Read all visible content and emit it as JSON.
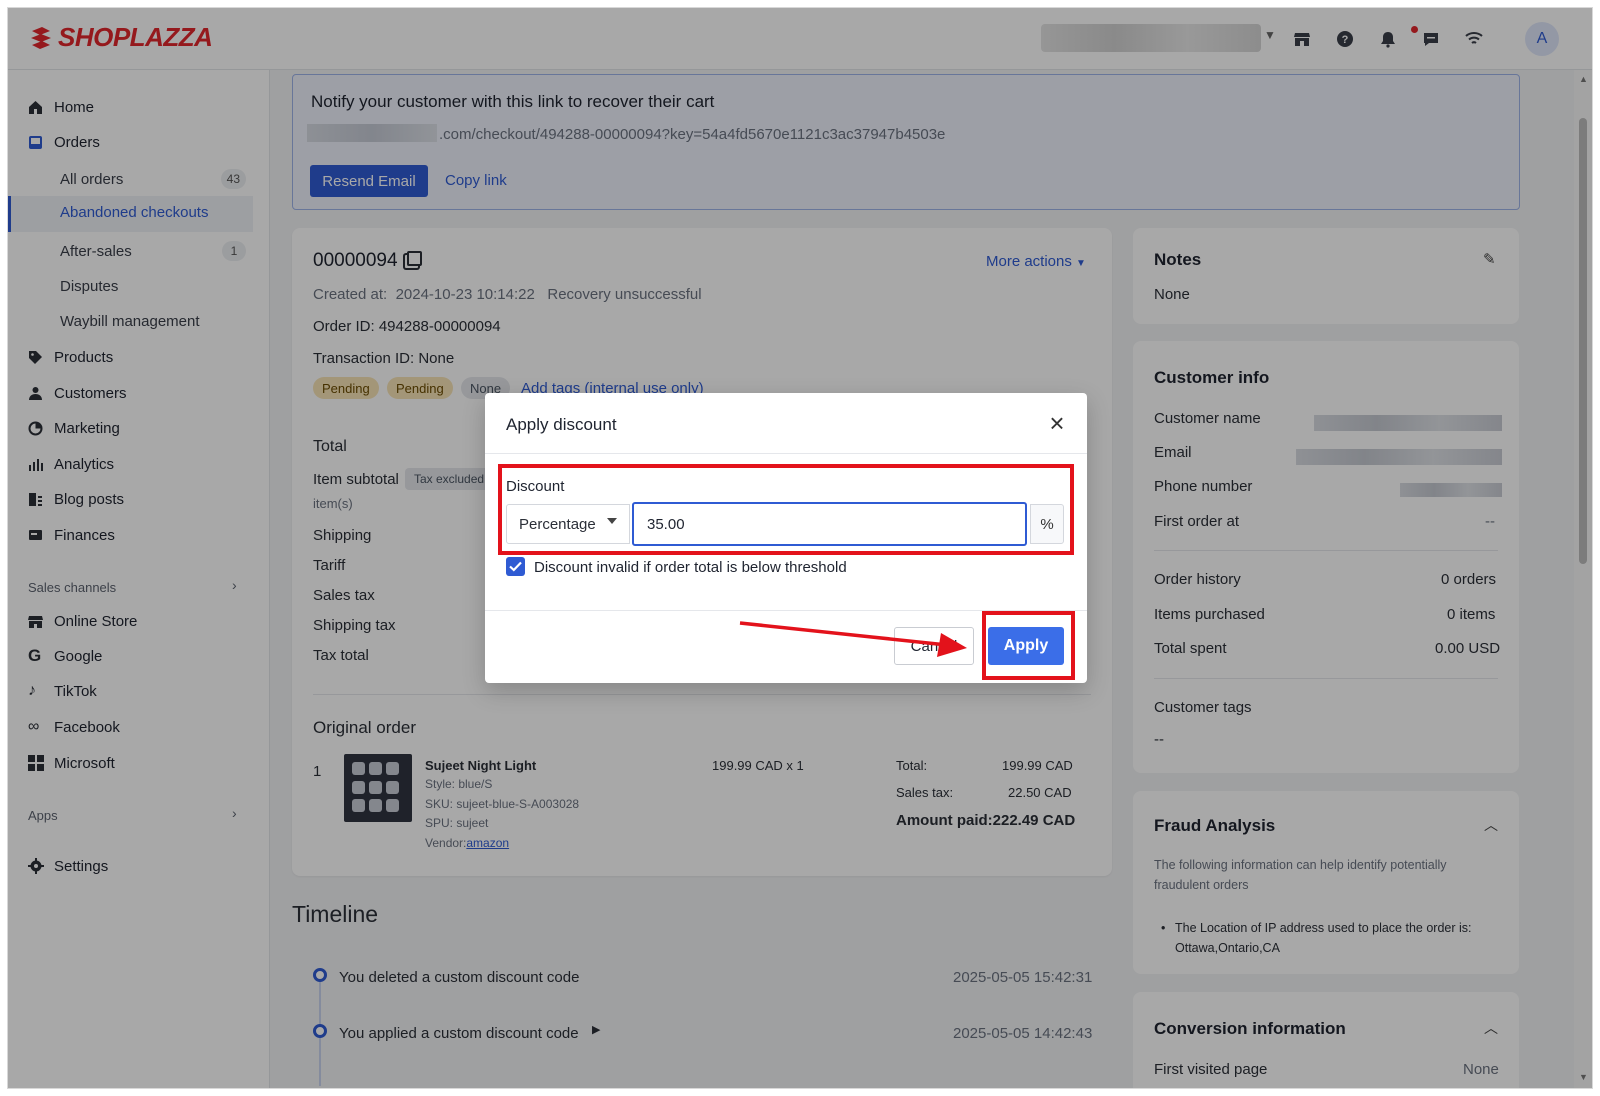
{
  "brand": {
    "name": "SHOPLAZZA",
    "color": "#e2262d"
  },
  "topbar": {
    "icons": [
      "store-icon",
      "help-icon",
      "bell-icon",
      "chat-icon",
      "wifi-icon"
    ],
    "avatar": "A"
  },
  "sidebar": {
    "items": [
      {
        "label": "Home",
        "icon": "home-icon"
      },
      {
        "label": "Orders",
        "icon": "orders-icon"
      },
      {
        "label": "Products",
        "icon": "tag-icon"
      },
      {
        "label": "Customers",
        "icon": "user-icon"
      },
      {
        "label": "Marketing",
        "icon": "marketing-icon"
      },
      {
        "label": "Analytics",
        "icon": "bar-chart-icon"
      },
      {
        "label": "Blog posts",
        "icon": "blog-icon"
      },
      {
        "label": "Finances",
        "icon": "finance-icon"
      }
    ],
    "orders_sub": [
      {
        "label": "All orders",
        "count": "43"
      },
      {
        "label": "Abandoned checkouts",
        "count": ""
      },
      {
        "label": "After-sales",
        "count": "1"
      },
      {
        "label": "Disputes",
        "count": ""
      },
      {
        "label": "Waybill management",
        "count": ""
      }
    ],
    "sales_channels_label": "Sales channels",
    "channels": [
      {
        "label": "Online Store",
        "icon": "store-icon"
      },
      {
        "label": "Google",
        "icon": "google-icon"
      },
      {
        "label": "TikTok",
        "icon": "tiktok-icon"
      },
      {
        "label": "Facebook",
        "icon": "meta-icon"
      },
      {
        "label": "Microsoft",
        "icon": "microsoft-icon"
      }
    ],
    "apps_label": "Apps",
    "settings_label": "Settings"
  },
  "banner": {
    "title": "Notify your customer with this link to recover their cart",
    "url": ".com/checkout/494288-00000094?key=54a4fd5670e1121c3ac37947b4503e",
    "resend_label": "Resend Email",
    "copy_label": "Copy link"
  },
  "order": {
    "number": "00000094",
    "more_actions": "More actions",
    "created_label": "Created at:",
    "created_value": "2024-10-23 10:14:22",
    "recovery_status": "Recovery unsuccessful",
    "order_id": "Order ID: 494288-00000094",
    "transaction_id": "Transaction ID: None",
    "tags": [
      "Pending",
      "Pending",
      "None"
    ],
    "add_tags": "Add tags (internal use only)",
    "total_heading": "Total",
    "item_subtotal": "Item subtotal",
    "tax_excluded": "Tax excluded",
    "items_label": "item(s)",
    "rows": [
      "Shipping",
      "Tariff",
      "Sales tax",
      "Shipping tax",
      "Tax total"
    ],
    "original_order_heading": "Original order",
    "line": {
      "index": "1",
      "name": "Sujeet Night Light",
      "style": "Style: blue/S",
      "sku": "SKU: sujeet-blue-S-A003028",
      "spu": "SPU: sujeet",
      "vendor_label": "Vendor:",
      "vendor": "amazon",
      "price_qty": "199.99 CAD x 1",
      "total_label": "Total:",
      "total_value": "199.99 CAD",
      "sales_tax_label": "Sales tax:",
      "sales_tax_value": "22.50 CAD",
      "amount_paid": "Amount paid:222.49 CAD"
    }
  },
  "timeline": {
    "heading": "Timeline",
    "events": [
      {
        "text": "You deleted a custom discount code",
        "time": "2025-05-05 15:42:31"
      },
      {
        "text": "You applied a custom discount code",
        "time": "2025-05-05 14:42:43"
      }
    ]
  },
  "notes": {
    "title": "Notes",
    "value": "None"
  },
  "customer": {
    "title": "Customer info",
    "name_label": "Customer name",
    "email_label": "Email",
    "phone_label": "Phone number",
    "first_order_label": "First order at",
    "first_order_value": "--",
    "order_history_label": "Order history",
    "order_history_value": "0 orders",
    "items_purchased_label": "Items purchased",
    "items_purchased_value": "0 items",
    "total_spent_label": "Total spent",
    "total_spent_value": "0.00 USD",
    "tags_label": "Customer tags",
    "tags_value": "--"
  },
  "fraud": {
    "title": "Fraud Analysis",
    "desc": "The following information can help identify potentially fraudulent orders",
    "bullet": "The Location of IP address used to place the order is: Ottawa,Ontario,CA"
  },
  "conversion": {
    "title": "Conversion information",
    "first_page_label": "First visited page",
    "first_page_value": "None"
  },
  "modal": {
    "title": "Apply discount",
    "discount_label": "Discount",
    "type_selected": "Percentage",
    "value": "35.00",
    "suffix": "%",
    "threshold_label": "Discount invalid if order total is below threshold",
    "threshold_checked": true,
    "cancel_label": "Cancel",
    "apply_label": "Apply"
  },
  "colors": {
    "primary": "#2f5bd3",
    "highlight": "#e3121b",
    "apply": "#3b6ee8"
  }
}
